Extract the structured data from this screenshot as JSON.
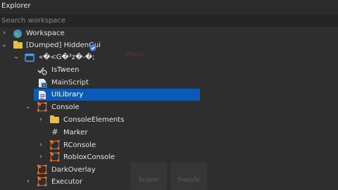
{
  "window": {
    "title": "Explorer"
  },
  "search": {
    "placeholder": "Search workspace"
  },
  "tree": [
    {
      "label": "Workspace",
      "icon": "globe-icon",
      "arrow": "›"
    },
    {
      "label": "[Dumped] HiddenGui",
      "icon": "folder-icon",
      "arrow": "⌄",
      "badge": "checkmark-badge-icon"
    },
    {
      "label": "«�<G�³z�-�;",
      "icon": "screen-gui-icon",
      "arrow": "⌄"
    },
    {
      "label": "IsTween",
      "icon": "bool-value-icon"
    },
    {
      "label": "MainScript",
      "icon": "local-script-icon"
    },
    {
      "label": "UILibrary",
      "icon": "module-script-icon",
      "selected": true
    },
    {
      "label": "Console",
      "icon": "frame-icon",
      "arrow": "⌄"
    },
    {
      "label": "ConsoleElements",
      "icon": "folder-icon",
      "arrow": "›"
    },
    {
      "label": "Marker",
      "icon": "hash-icon"
    },
    {
      "label": "RConsole",
      "icon": "frame-icon",
      "arrow": "›"
    },
    {
      "label": "RobloxConsole",
      "icon": "frame-icon",
      "arrow": "›"
    },
    {
      "label": "DarkOverlay",
      "icon": "frame-icon"
    },
    {
      "label": "Executor",
      "icon": "frame-icon",
      "arrow": "›"
    }
  ],
  "background": {
    "ghost_buttons": [
      "Sniper",
      "Swuvle"
    ],
    "faint_text": "Mouss"
  },
  "colors": {
    "selection": "#0b5bb6",
    "frame_icon": "#e36b1e",
    "folder_icon": "#e6c04c"
  }
}
